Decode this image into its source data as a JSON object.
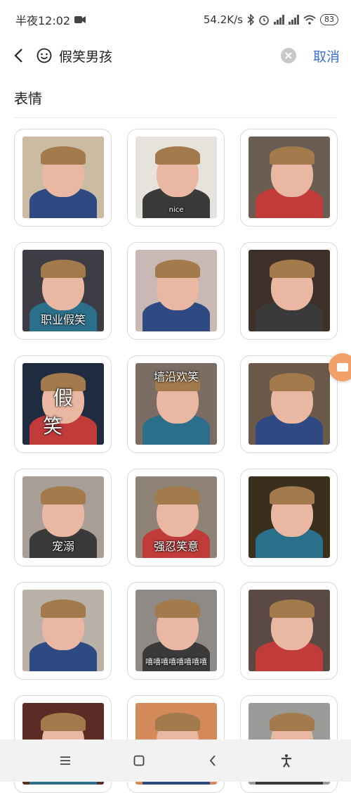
{
  "status": {
    "time": "半夜12:02",
    "net_speed": "54.2K/s",
    "battery": "83"
  },
  "header": {
    "query": "假笑男孩",
    "cancel_label": "取消"
  },
  "section": {
    "title": "表情"
  },
  "stickers": [
    {
      "caption": "",
      "bg": "#cbbba3"
    },
    {
      "caption": "nice",
      "bg": "#e6e2dc"
    },
    {
      "caption": "",
      "bg": "#6a5d52"
    },
    {
      "caption": "职业假笑",
      "bg": "#3d3b44"
    },
    {
      "caption": "",
      "bg": "#c9b8b4"
    },
    {
      "caption": "",
      "bg": "#3c3028"
    },
    {
      "caption": "假笑",
      "bg": "#1f2b3f"
    },
    {
      "caption": "墙沿欢笑",
      "bg": "#7b6c64"
    },
    {
      "caption": "",
      "bg": "#6b5a4a"
    },
    {
      "caption": "宠溺",
      "bg": "#a89e96"
    },
    {
      "caption": "强忍笑意",
      "bg": "#8e8376"
    },
    {
      "caption": "",
      "bg": "#3a2e1c"
    },
    {
      "caption": "",
      "bg": "#b9b1a8"
    },
    {
      "caption": "嘻嘻嘻嘻嘻嘻嘻嘻",
      "bg": "#8f8a86"
    },
    {
      "caption": "",
      "bg": "#5b4a44"
    },
    {
      "caption": "",
      "bg": "#5b2b25"
    },
    {
      "caption": "",
      "bg": "#d58a5b"
    },
    {
      "caption": "",
      "bg": "#9a9a98"
    }
  ],
  "colors": {
    "accent": "#3a6fd8",
    "float_button": "#f2a06a"
  },
  "icons": {
    "back": "chevron-left-icon",
    "emoji": "smile-icon",
    "clear": "close-circle-icon",
    "nav_menu": "menu-icon",
    "nav_home": "square-icon",
    "nav_back": "chevron-left-icon",
    "nav_accessibility": "accessibility-icon"
  }
}
